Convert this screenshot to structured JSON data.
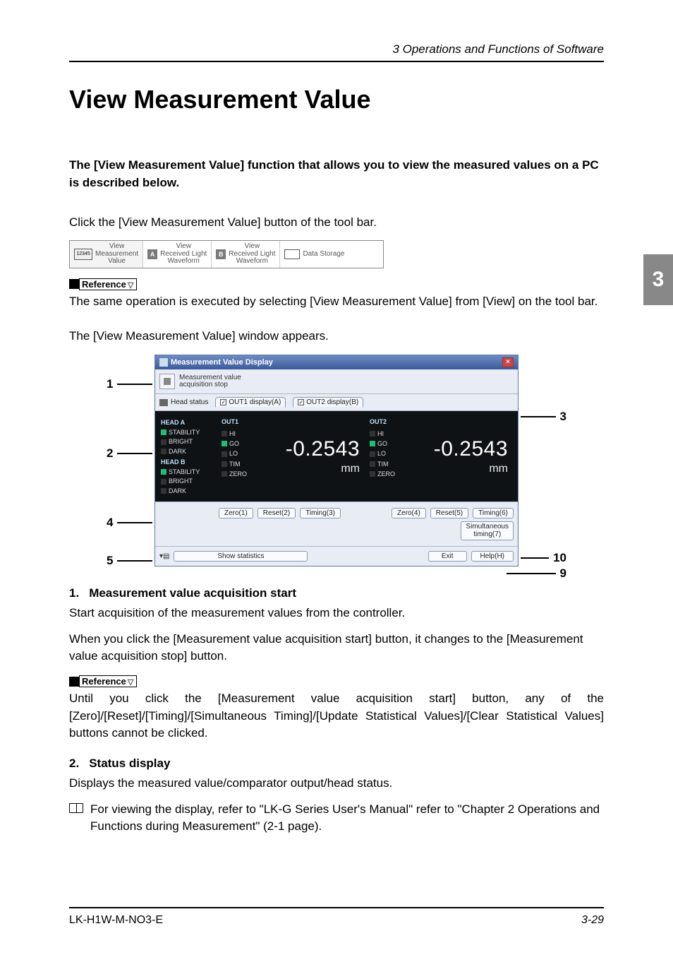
{
  "header": {
    "running": "3  Operations and Functions of Software"
  },
  "title": "View Measurement Value",
  "intro": "The [View Measurement Value] function that allows you to view the measured values on a PC is described below.",
  "p1": "Click the [View Measurement Value] button of the tool bar.",
  "toolbar": {
    "btn1": {
      "icon_text": "12345",
      "line1": "View",
      "line2": "Measurement",
      "line3": "Value"
    },
    "btn2": {
      "badge": "A",
      "line1": "View",
      "line2": "Received Light",
      "line3": "Waveform"
    },
    "btn3": {
      "badge": "B",
      "line1": "View",
      "line2": "Received Light",
      "line3": "Waveform"
    },
    "btn4": {
      "line1": "Data Storage"
    }
  },
  "reference_label": "Reference",
  "p2": "The same operation is executed by selecting [View Measurement Value] from [View] on the tool bar.",
  "p3": "The [View Measurement Value] window appears.",
  "window": {
    "title": "Measurement Value Display",
    "acq_label_l1": "Measurement value",
    "acq_label_l2": "acquisition stop",
    "head_tab": "Head status",
    "tab1": "OUT1 display(A)",
    "tab2": "OUT2 display(B)",
    "heads": {
      "a_title": "HEAD A",
      "b_title": "HEAD B",
      "rows": [
        "STABILITY",
        "BRIGHT",
        "DARK"
      ]
    },
    "out1": {
      "title": "OUT1",
      "indicators": [
        "HI",
        "GO",
        "LO",
        "TIM",
        "ZERO"
      ],
      "value": "-0.2543",
      "unit": "mm"
    },
    "out2": {
      "title": "OUT2",
      "indicators": [
        "HI",
        "GO",
        "LO",
        "TIM",
        "ZERO"
      ],
      "value": "-0.2543",
      "unit": "mm"
    },
    "buttons": {
      "z1": "Zero(1)",
      "r2": "Reset(2)",
      "t3": "Timing(3)",
      "z4": "Zero(4)",
      "r5": "Reset(5)",
      "t6": "Timing(6)",
      "sim_l1": "Simultaneous",
      "sim_l2": "timing(7)"
    },
    "stats": "Show statistics",
    "exit": "Exit",
    "help": "Help(H)"
  },
  "callouts": {
    "c1": "1",
    "c2": "2",
    "c3": "3",
    "c4": "4",
    "c5": "5",
    "c9": "9",
    "c10": "10"
  },
  "sec1": {
    "num": "1.",
    "title": "Measurement value acquisition start",
    "p1": "Start acquisition of the measurement values from the controller.",
    "p2": "When you click the [Measurement value acquisition start] button, it changes to the [Measurement value acquisition stop] button."
  },
  "ref2": "Until you click the [Measurement value acquisition start] button, any of the [Zero]/[Reset]/[Timing]/[Simultaneous Timing]/[Update Statistical Values]/[Clear Statistical Values] buttons cannot be clicked.",
  "sec2": {
    "num": "2.",
    "title": "Status display",
    "p1": "Displays the measured value/comparator output/head status.",
    "note": "For viewing the display, refer to \"LK-G  Series User's Manual\" refer to \"Chapter 2 Operations and Functions during Measurement\" (2-1 page)."
  },
  "side_tab": "3",
  "footer": {
    "left": "LK-H1W-M-NO3-E",
    "right": "3-29"
  }
}
